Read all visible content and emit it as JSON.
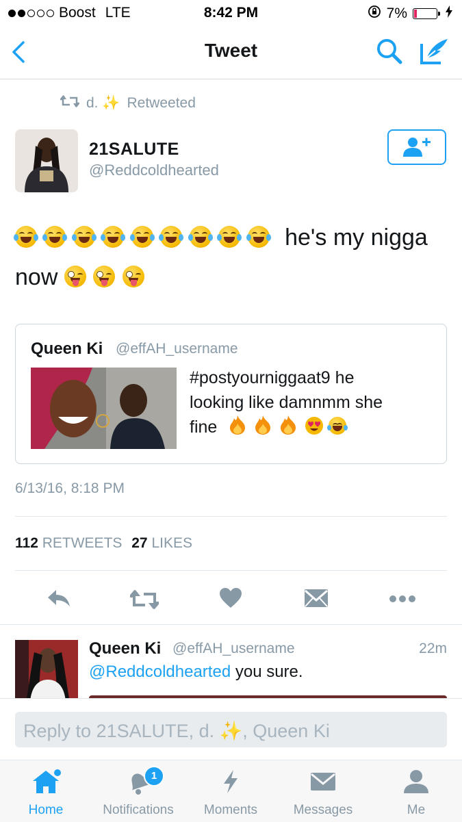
{
  "status_bar": {
    "carrier": "Boost",
    "network": "LTE",
    "time": "8:42 PM",
    "battery": "7%"
  },
  "nav": {
    "title": "Tweet"
  },
  "retweet_context": {
    "retweeter": "d. ✨",
    "label": "Retweeted"
  },
  "tweet": {
    "author_name": "21SALUTE",
    "author_handle": "@Reddcoldhearted",
    "text_part1": "he's my nigga",
    "text_part2": "now",
    "timestamp": "6/13/16, 8:18 PM",
    "retweet_count": "112",
    "retweet_label": "RETWEETS",
    "like_count": "27",
    "like_label": "LIKES"
  },
  "quoted_tweet": {
    "name": "Queen Ki",
    "handle": "@effAH_username",
    "text_line1": "#postyourniggaat9 he",
    "text_line2": "looking like damnmm she",
    "text_line3": "fine"
  },
  "reply": {
    "name": "Queen Ki",
    "handle": "@effAH_username",
    "time": "22m",
    "mention": "@Reddcoldhearted",
    "text": " you sure."
  },
  "composer": {
    "placeholder": "Reply to 21SALUTE, d. ✨, Queen Ki"
  },
  "tabbar": {
    "tabs": [
      {
        "label": "Home"
      },
      {
        "label": "Notifications"
      },
      {
        "label": "Moments"
      },
      {
        "label": "Messages"
      },
      {
        "label": "Me"
      }
    ],
    "notifications_badge": "1"
  },
  "colors": {
    "accent": "#1da1f2",
    "secondary_text": "#8899a6",
    "primary_text": "#14171a"
  }
}
